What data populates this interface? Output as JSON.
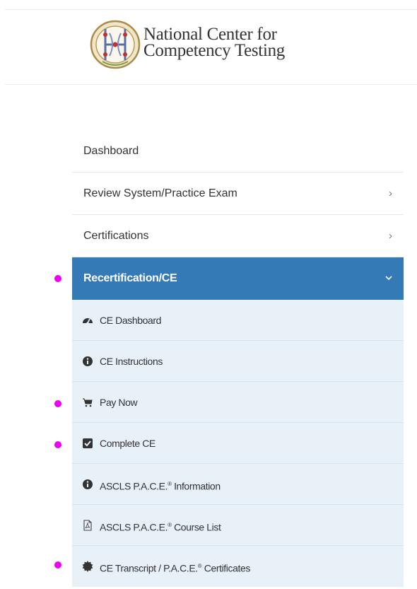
{
  "logo": {
    "line1": "National Center for",
    "line2": "Competency Testing",
    "seal_icon": "ncct-seal-icon"
  },
  "menu": {
    "items": [
      {
        "label": "Dashboard"
      },
      {
        "label": "Review System/Practice Exam",
        "chevron": "›"
      },
      {
        "label": "Certifications",
        "chevron": "›"
      },
      {
        "label": "Recertification/CE",
        "active": true
      }
    ],
    "active_color": "#337ab7",
    "submenu_color": "#e8f0f8"
  },
  "submenu": {
    "items": [
      {
        "label": "CE Dashboard",
        "icon": "tachometer-icon"
      },
      {
        "label": "CE Instructions",
        "icon": "info-circle-icon"
      },
      {
        "label": "Pay Now",
        "icon": "shopping-cart-icon"
      },
      {
        "label": "Complete CE",
        "icon": "check-square-icon"
      },
      {
        "label_prefix": "ASCLS P.A.C.E.",
        "label_sup": "®",
        "label_suffix": " Information",
        "icon": "info-circle-icon"
      },
      {
        "label_prefix": "ASCLS P.A.C.E.",
        "label_sup": "®",
        "label_suffix": " Course List",
        "icon": "file-pdf-icon"
      },
      {
        "label_prefix": "CE Transcript / P.A.C.E.",
        "label_sup": "®",
        "label_suffix": " Certificates",
        "icon": "certificate-icon"
      }
    ]
  },
  "markers": {
    "color": "#f000f0"
  }
}
